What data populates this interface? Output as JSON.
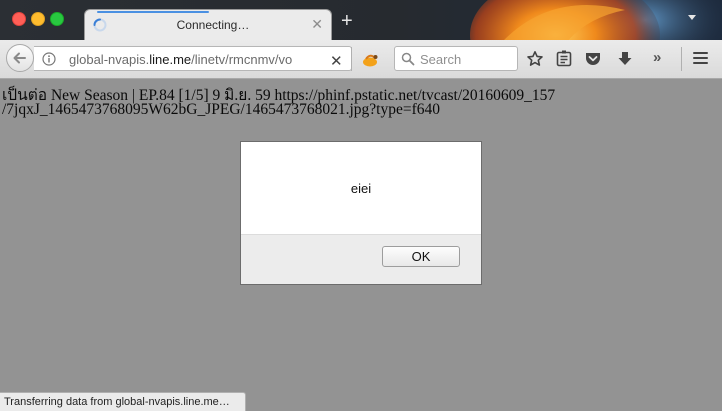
{
  "window": {
    "tab_title": "Connecting…",
    "new_tab_label": "+"
  },
  "toolbar": {
    "url_prefix": "global-nvapis.",
    "url_domain": "line.me",
    "url_path": "/linetv/rmcnmv/vo",
    "stop_label": "✕",
    "search_placeholder": "Search",
    "overflow_label": "»"
  },
  "page": {
    "line1": "เป็นต่อ New Season | EP.84 [1/5] 9 มิ.ย. 59 https://phinf.pstatic.net/tvcast/20160609_157",
    "line2": "/7jqxJ_1465473768095W62bG_JPEG/1465473768021.jpg?type=f640"
  },
  "dialog": {
    "message": "eiei",
    "ok_label": "OK"
  },
  "status_bar": {
    "text": "Transferring data from global-nvapis.line.me…"
  },
  "colors": {
    "page_background": "#939393",
    "loading_accent": "#4a90e2"
  }
}
